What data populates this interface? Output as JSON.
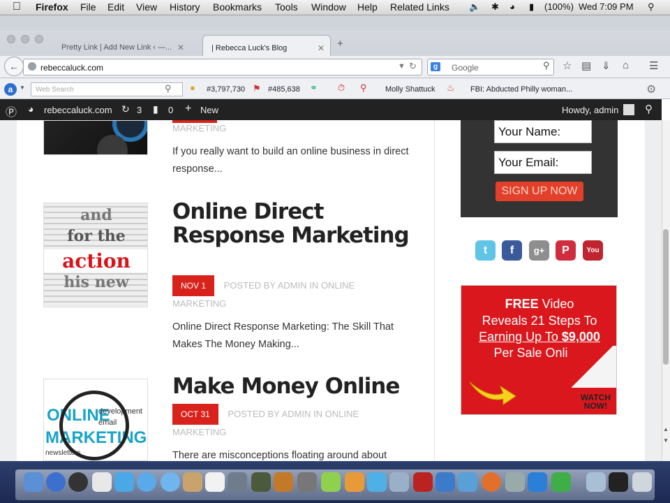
{
  "menubar": {
    "app": "Firefox",
    "items": [
      "File",
      "Edit",
      "View",
      "History",
      "Bookmarks",
      "Tools",
      "Window",
      "Help",
      "Related Links"
    ],
    "battery": "(100%)",
    "clock": "Wed 7:09 PM"
  },
  "tabs": [
    {
      "label": "Pretty Link | Add New Link ‹ —...",
      "active": false
    },
    {
      "label": "| Rebecca Luck's Blog",
      "active": true
    }
  ],
  "url": "rebeccaluck.com",
  "search_placeholder": "Google",
  "toolbar": {
    "web_search_placeholder": "Web Search",
    "rank1": "#3,797,730",
    "rank2": "#485,638",
    "link1": "Molly Shattuck",
    "link2": "FBI: Abducted Philly woman..."
  },
  "adminbar": {
    "site": "rebeccaluck.com",
    "updates": "3",
    "comments": "0",
    "new": "New",
    "greeting": "Howdy, admin"
  },
  "posts": [
    {
      "meta_tail": "MARKETING",
      "excerpt": "If you really want to build an online business in direct response..."
    },
    {
      "title": "Online Direct Response Marketing",
      "date": "NOV 1",
      "meta": "POSTED BY ADMIN IN ONLINE",
      "meta_tail": "MARKETING",
      "excerpt": "Online Direct Response Marketing: The Skill That Makes The Money Making...",
      "thumb_words": [
        "and",
        "for the",
        "action",
        "his new"
      ]
    },
    {
      "title": "Make Money Online",
      "date": "OCT 31",
      "meta": "POSTED BY ADMIN IN ONLINE",
      "meta_tail": "MARKETING",
      "excerpt": "There are misconceptions floating around about",
      "thumb_words": [
        "ONLINE",
        "MARKETING",
        "development",
        "email",
        "newsletters"
      ]
    }
  ],
  "sidebar": {
    "name_field": "Your Name:",
    "email_field": "Your Email:",
    "signup": "SIGN UP NOW",
    "ad": {
      "free": "FREE",
      "line1": "Video",
      "line2": "Reveals 21 Steps To",
      "line3a": "Earning Up To ",
      "line3b": "$9,000",
      "line4": "Per Sale Online!",
      "watch": "WATCH",
      "now": "NOW!"
    }
  },
  "colors": {
    "accent": "#d9221c",
    "adminbar": "#222222"
  }
}
